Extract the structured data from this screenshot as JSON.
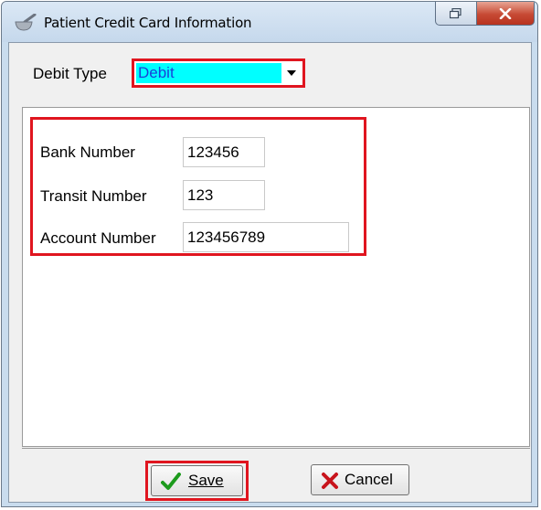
{
  "window": {
    "title": "Patient Credit Card Information",
    "buttons": [
      "restore",
      "close"
    ]
  },
  "debit": {
    "label": "Debit Type",
    "selected": "Debit"
  },
  "fields": [
    {
      "label": "Bank Number",
      "value": "123456"
    },
    {
      "label": "Transit Number",
      "value": "123"
    },
    {
      "label": "Account Number",
      "value": "123456789"
    }
  ],
  "actions": {
    "save_label": "Save",
    "cancel_label": "Cancel"
  },
  "icons": {
    "app": "mortar-pestle-icon",
    "save": "checkmark-icon",
    "cancel": "x-icon"
  },
  "colors": {
    "highlight_border": "#e0151f",
    "selection_bg": "#00ffff",
    "selection_text": "#1a3fd8",
    "close_button": "#c74a34"
  }
}
